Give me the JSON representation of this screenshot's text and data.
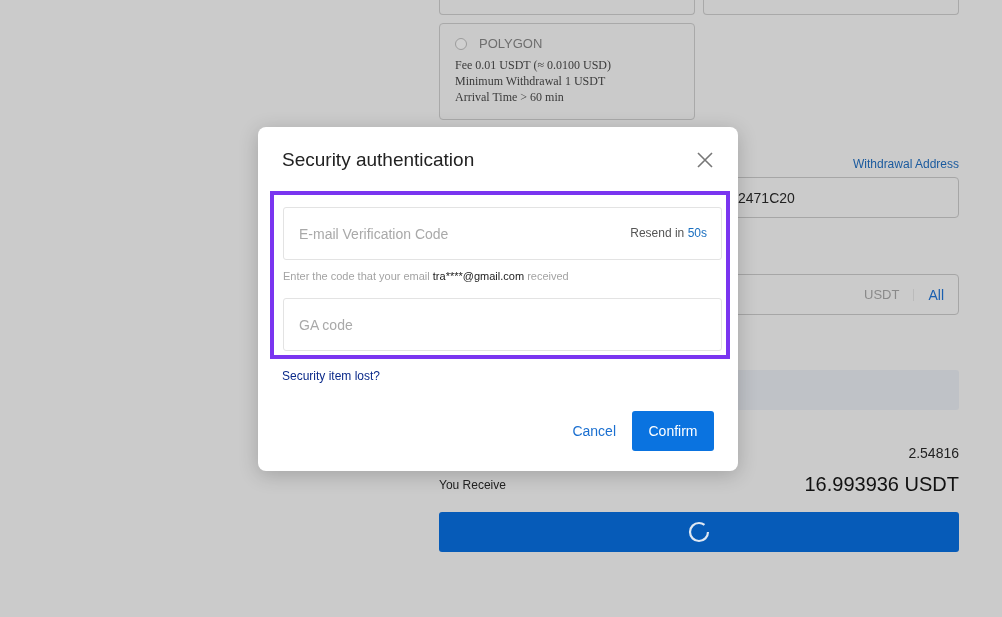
{
  "networks": [
    {
      "selected": false
    },
    {
      "selected": false
    },
    {
      "name": "POLYGON",
      "selected": false,
      "details": [
        "Fee 0.01 USDT (≈ 0.0100 USD)",
        "Minimum Withdrawal 1 USDT",
        "Arrival Time > 60 min"
      ]
    }
  ],
  "withdrawal_address": {
    "label": "Withdrawal Address",
    "value": "2471C20"
  },
  "amount": {
    "unit": "USDT",
    "all_link": "All"
  },
  "fee_value": "2.54816",
  "receive": {
    "label": "You Receive",
    "value": "16.993936 USDT"
  },
  "submit": {
    "loading": true
  },
  "dialog": {
    "title": "Security authentication",
    "email_field": {
      "placeholder": "E-mail Verification Code",
      "resend_label": "Resend in",
      "resend_time": "50s"
    },
    "hint": {
      "before": "Enter the code that your email",
      "email": "tra****@gmail.com",
      "after": "received"
    },
    "ga_field": {
      "placeholder": "GA code"
    },
    "lost_link": "Security item lost?",
    "cancel": "Cancel",
    "confirm": "Confirm"
  }
}
